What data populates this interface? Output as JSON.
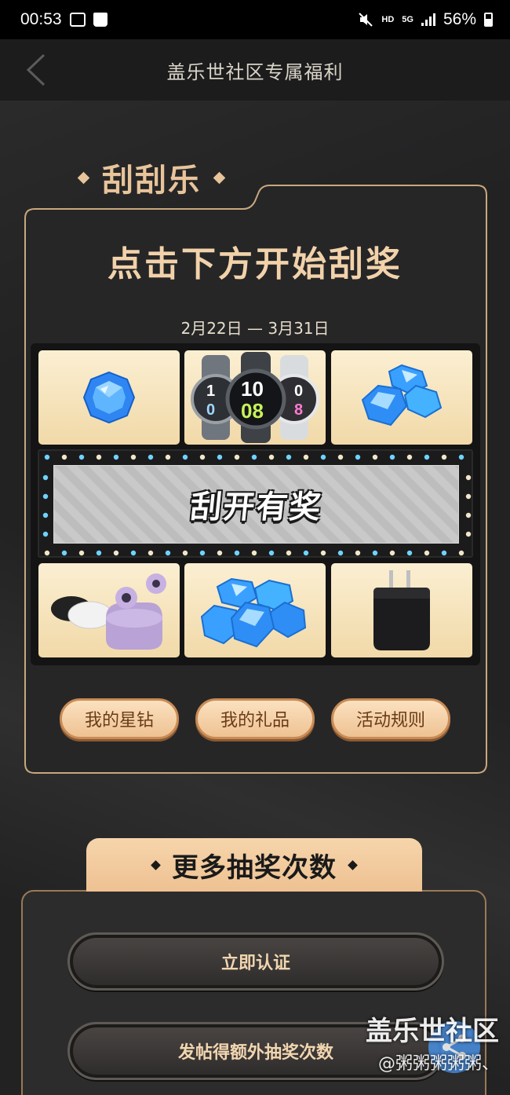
{
  "status_bar": {
    "time": "00:53",
    "network": "HD",
    "network_gen": "5G",
    "battery": "56%"
  },
  "nav": {
    "title": "盖乐世社区专属福利",
    "back_icon": "chevron-left-icon"
  },
  "scratch": {
    "tab_title": "刮刮乐",
    "heading": "点击下方开始刮奖",
    "date_range": "2月22日 — 3月31日",
    "scratch_label": "刮开有奖",
    "prizes": [
      {
        "name": "single-gem-prize",
        "icon": "gem-icon"
      },
      {
        "name": "smartwatch-prize",
        "icon": "watch-icon"
      },
      {
        "name": "gem-pile-prize",
        "icon": "gems-icon"
      },
      {
        "name": "earbuds-prize",
        "icon": "earbuds-icon"
      },
      {
        "name": "large-gem-pile-prize",
        "icon": "gems-icon"
      },
      {
        "name": "charger-prize",
        "icon": "charger-icon"
      }
    ],
    "watch_faces": {
      "center_top": "10",
      "center_bottom": "08",
      "left_top": "1",
      "left_bottom": "0",
      "right_top": "0",
      "right_bottom": "8"
    },
    "buttons": {
      "my_stardiamonds": "我的星钻",
      "my_gifts": "我的礼品",
      "rules": "活动规则"
    }
  },
  "more": {
    "tab_title": "更多抽奖次数",
    "verify_button": "立即认证",
    "post_button": "发帖得额外抽奖次数"
  },
  "watermark": {
    "title": "盖乐世社区",
    "user": "@粥粥粥粥粥、"
  },
  "colors": {
    "accent_gold": "#e8c49a",
    "card_border": "#c9a77c",
    "tile_light": "#fbefd2",
    "gem_blue": "#3aa0ff"
  }
}
